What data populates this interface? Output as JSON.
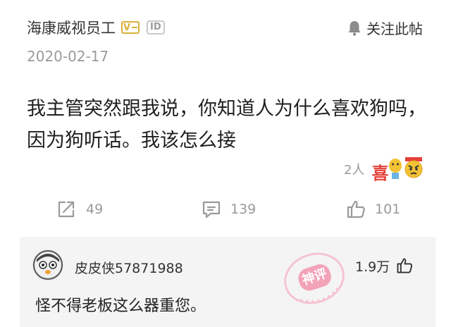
{
  "post": {
    "author": "海康威视员工",
    "id_badge": "ID",
    "follow_label": "关注此帖",
    "date": "2020-02-17",
    "content": "我主管突然跟我说，你知道人为什么喜欢狗吗，因为狗听话。我该怎么接",
    "reactions_label": "2人",
    "reaction_emoji_text": "喜",
    "share_count": "49",
    "comment_count": "139",
    "like_count": "101"
  },
  "comment": {
    "username": "皮皮侠57871988",
    "likes": "1.9万",
    "text": "怪不得老板这么器重您。",
    "stamp_text": "神评"
  },
  "colors": {
    "text": "#222222",
    "muted": "#9a9a9a",
    "verified_badge": "#d8b23a",
    "comment_bg": "#f4f4f4",
    "stamp": "#f3a3b8"
  },
  "icons": [
    "verified-badge",
    "id-badge",
    "bell-icon",
    "share-icon",
    "comment-icon",
    "thumbs-up-icon",
    "avatar",
    "reaction-emoji"
  ]
}
